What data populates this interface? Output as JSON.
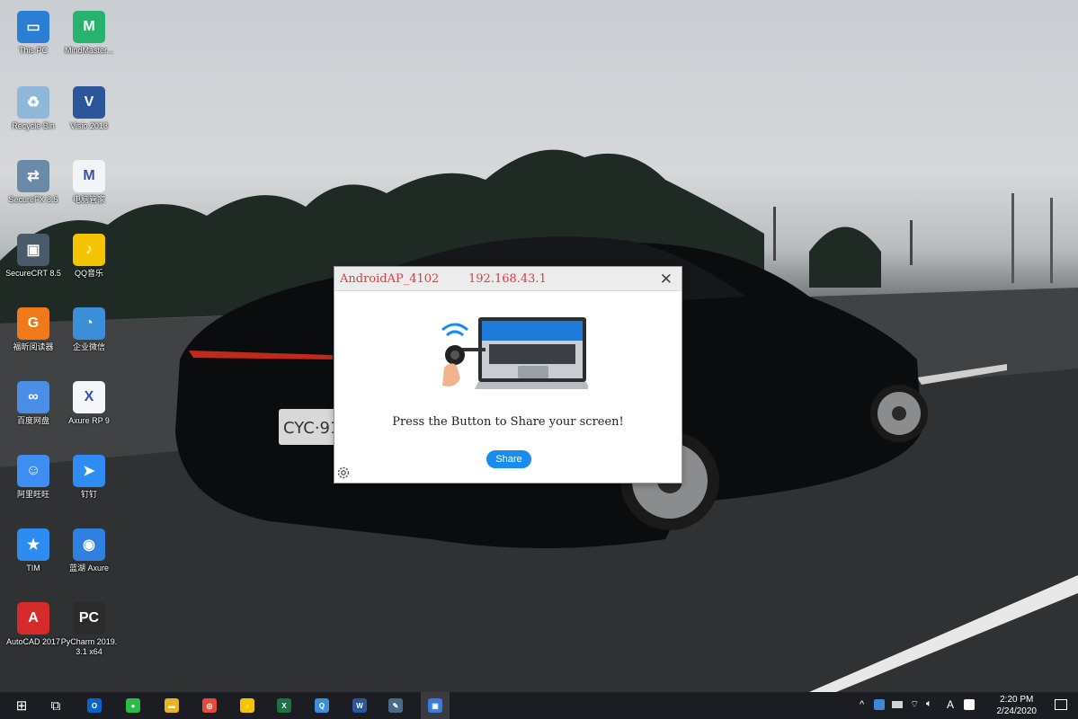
{
  "desktop": {
    "icons": [
      {
        "label": "This PC",
        "color": "#2a7fd4",
        "glyph": "▭",
        "icon": "computer-icon"
      },
      {
        "label": "MindMaster...",
        "color": "#27b36f",
        "glyph": "M",
        "icon": "mindmaster-icon"
      },
      {
        "label": "Recycle Bin",
        "color": "#8fb8d8",
        "glyph": "♻",
        "icon": "recycle-bin-icon"
      },
      {
        "label": "Visio 2013",
        "color": "#2b579a",
        "glyph": "V",
        "icon": "visio-icon"
      },
      {
        "label": "SecureFX 8.5",
        "color": "#6a8aa8",
        "glyph": "⇄",
        "icon": "securefx-icon"
      },
      {
        "label": "电脑管家",
        "color": "#f2f4f8",
        "glyph": "M",
        "icon": "pc-manager-icon"
      },
      {
        "label": "SecureCRT 8.5",
        "color": "#4a5a6a",
        "glyph": "▣",
        "icon": "securecrt-icon"
      },
      {
        "label": "QQ音乐",
        "color": "#f5c400",
        "glyph": "♪",
        "icon": "qq-music-icon"
      },
      {
        "label": "福昕阅读器",
        "color": "#f07a1a",
        "glyph": "G",
        "icon": "foxit-reader-icon"
      },
      {
        "label": "企业微信",
        "color": "#3b8fd8",
        "glyph": "◔",
        "icon": "wecom-icon"
      },
      {
        "label": "百度网盘",
        "color": "#4a8ee8",
        "glyph": "∞",
        "icon": "baidu-netdisk-icon"
      },
      {
        "label": "Axure RP 9",
        "color": "#f4f6fa",
        "glyph": "X",
        "icon": "axure-icon"
      },
      {
        "label": "阿里旺旺",
        "color": "#3d8ef0",
        "glyph": "☺",
        "icon": "aliwangwang-icon"
      },
      {
        "label": "钉钉",
        "color": "#2f8cf0",
        "glyph": "➤",
        "icon": "dingtalk-icon"
      },
      {
        "label": "TIM",
        "color": "#2d8cf0",
        "glyph": "★",
        "icon": "tim-icon"
      },
      {
        "label": "蓝湖 Axure",
        "color": "#2f80e0",
        "glyph": "◉",
        "icon": "lanhu-icon"
      },
      {
        "label": "AutoCAD 2017",
        "color": "#d52b2b",
        "glyph": "A",
        "icon": "autocad-icon"
      },
      {
        "label": "PyCharm 2019.3.1 x64",
        "color": "#2b2b2b",
        "glyph": "PC",
        "icon": "pycharm-icon"
      }
    ]
  },
  "dialog": {
    "device_name": "AndroidAP_4102",
    "ip_address": "192.168.43.1",
    "message": "Press the Button to Share your screen!",
    "share_label": "Share",
    "title_color": "#e23b3b",
    "button_color": "#1a8cf0"
  },
  "taskbar": {
    "apps": [
      {
        "icon": "start-icon",
        "glyph": "⊞",
        "color": "transparent"
      },
      {
        "icon": "task-view-icon",
        "glyph": "⧉",
        "color": "transparent"
      },
      {
        "icon": "outlook-icon",
        "glyph": "O",
        "color": "#0a64c8"
      },
      {
        "icon": "wechat-icon",
        "glyph": "●",
        "color": "#2bbd4a"
      },
      {
        "icon": "file-explorer-icon",
        "glyph": "▬",
        "color": "#e8b423"
      },
      {
        "icon": "chrome-icon",
        "glyph": "◎",
        "color": "#e24b3b"
      },
      {
        "icon": "qq-music-taskbar-icon",
        "glyph": "♪",
        "color": "#f5c400"
      },
      {
        "icon": "excel-icon",
        "glyph": "X",
        "color": "#1e7145"
      },
      {
        "icon": "wecom-taskbar-icon",
        "glyph": "Q",
        "color": "#3b8fd8"
      },
      {
        "icon": "word-icon",
        "glyph": "W",
        "color": "#2b579a"
      },
      {
        "icon": "sketch-tool-icon",
        "glyph": "✎",
        "color": "#4a6a8a"
      },
      {
        "icon": "screen-share-app-icon",
        "glyph": "▣",
        "color": "#3a7ad8"
      }
    ],
    "tray": {
      "time": "2:20 PM",
      "date": "2/24/2020",
      "input_indicator": "A"
    }
  }
}
